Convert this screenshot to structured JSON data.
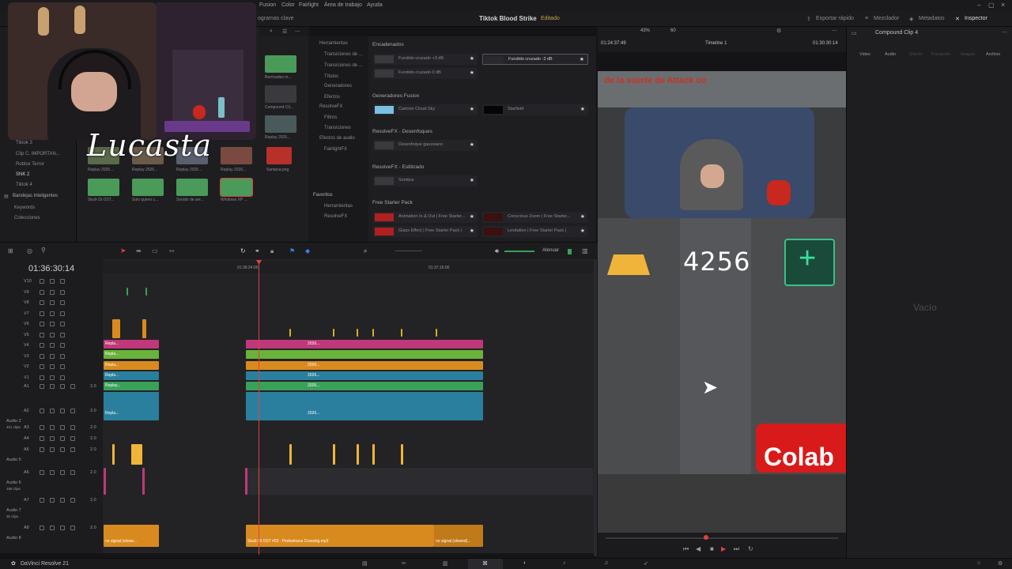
{
  "menu": {
    "items": [
      "Fusion",
      "Color",
      "Fairlight",
      "Área de trabajo",
      "Ayuda"
    ]
  },
  "project": {
    "title": "Tiktok Blood Strike",
    "status": "Editado"
  },
  "top_toolbar": {
    "media_pool_fragment": "ogramas clave",
    "quick_export": "Exportar rápido",
    "mixer": "Mezclador",
    "metadata": "Metadatos",
    "inspector": "Inspector"
  },
  "overlay": {
    "logo_text": "Lucasta"
  },
  "bins": {
    "items": [
      "Tiktok 3",
      "Clip C, IMPORTAN...",
      "Roblox Terror",
      "SNK 2",
      "Tiktok 4"
    ],
    "smart_bins_label": "Bandejas inteligentes",
    "smart_items": [
      "Keywords",
      "Colecciones"
    ]
  },
  "media_pool": {
    "clips": [
      {
        "label": "Replay 2026...",
        "color": "#5a6a4a"
      },
      {
        "label": "Replay 2026...",
        "color": "#6a5a4a"
      },
      {
        "label": "Replay 2026...",
        "color": "#5a6070"
      },
      {
        "label": "Replay 2026...",
        "color": "#7a4a40"
      },
      {
        "label": "Santana.png",
        "color": "#b8302a"
      },
      {
        "label": "Skull-19 OST...",
        "color": "#4a9a5a"
      },
      {
        "label": "Solo quiero c...",
        "color": "#4a9a5a"
      },
      {
        "label": "Sonido de ser...",
        "color": "#4a9a5a"
      },
      {
        "label": "Windows XP ...",
        "color": "#4a9a5a"
      }
    ],
    "right_column": [
      {
        "label": "Barricades m...",
        "color": "#4a9a5a"
      },
      {
        "label": "Compound Cli...",
        "color": "#3a3a3e"
      },
      {
        "label": "Replay 2026...",
        "color": "#4a5a5a"
      }
    ]
  },
  "effects_tree": {
    "nodes": [
      "Herramientas",
      "Transiciones de ...",
      "Transiciones de ...",
      "Títulos",
      "Generadores",
      "Efectos",
      "ResolveFX",
      "Filtros",
      "Transiciones",
      "Efectos de audio",
      "FairlightFX"
    ],
    "favorites_label": "Favoritos",
    "favorite_items": [
      "Herramientas",
      "ResolveFX"
    ]
  },
  "effects_list": {
    "sections": [
      {
        "title": "Encadenados",
        "items": [
          "Fundido cruzado +3 dB",
          "Fundido cruzado -3 dB",
          "Fundido cruzado 0 dB"
        ]
      },
      {
        "title": "Generadores Fusion",
        "items": [
          "Cartoon Cloud Sky",
          "Starfield"
        ]
      },
      {
        "title": "ResolveFX - Desenfoques",
        "items": [
          "Desenfoque gaussiano"
        ]
      },
      {
        "title": "ResolveFX - Estilizado",
        "items": [
          "Sombra"
        ]
      },
      {
        "title": "Free Starter Pack",
        "items": [
          "Animation In & Out | Free Starter...",
          "Conscious Zoom | Free Starter...",
          "Glass Effect | Free Starter Pack |",
          "Levitation | Free Starter Pack |"
        ]
      }
    ]
  },
  "viewer": {
    "zoom": "43%",
    "fps": "60",
    "timecode_left": "01:24:37:49",
    "timeline_name": "Timeline 1",
    "timecode_right": "01:30:30:14",
    "banner_text": "de la suerte de Attack on",
    "coin_count": "4256",
    "bottom_text": "Colab"
  },
  "inspector": {
    "clip_name": "Compound Clip 4",
    "tabs": [
      "Video",
      "Audio",
      "Efecto",
      "Transición",
      "Imagen",
      "Archivo"
    ],
    "empty_label": "Vacío"
  },
  "timeline": {
    "timecode": "01:36:30:14",
    "ruler_marks": [
      "01:36:24:00",
      "01:37:16:00"
    ],
    "video_tracks": [
      "V10",
      "V9",
      "V8",
      "V7",
      "V6",
      "V5",
      "V4",
      "V3",
      "V2",
      "V1"
    ],
    "audio_tracks": [
      {
        "id": "A1",
        "name": "",
        "meta": "2.0"
      },
      {
        "id": "A2",
        "name": "Audio 2",
        "meta": "2.0",
        "clips": "401 clips"
      },
      {
        "id": "A3",
        "name": "",
        "meta": "2.0"
      },
      {
        "id": "A4",
        "name": "",
        "meta": "2.0"
      },
      {
        "id": "A5",
        "name": "Audio 5",
        "meta": "2.0"
      },
      {
        "id": "A6",
        "name": "Audio 6",
        "meta": "2.0",
        "clips": "158 clips"
      },
      {
        "id": "A7",
        "name": "Audio 7",
        "meta": "2.0",
        "clips": "36 clips"
      },
      {
        "id": "A8",
        "name": "Audio 8",
        "meta": "2.0"
      }
    ],
    "attenuate_label": "Atenuar",
    "clip_labels": {
      "replay": "Repla...",
      "repl": "Repl...",
      "year": "2026...",
      "a2_left": "Replay...",
      "a8_left": "no signal (slowe...",
      "a8_mid": "Skull-19 OST #03 - Pedestrians Crossing.mp3",
      "a8_right": "no signal (slowed)..."
    }
  },
  "bottom": {
    "app_name": "DaVinci Resolve 21"
  },
  "colors": {
    "pink": "#c0387a",
    "green": "#6ab23a",
    "orange": "#d98a1f",
    "teal": "#2b7f9e",
    "audio_green": "#3aa05a",
    "playhead": "#e0413c",
    "gold": "#f0b43a"
  }
}
